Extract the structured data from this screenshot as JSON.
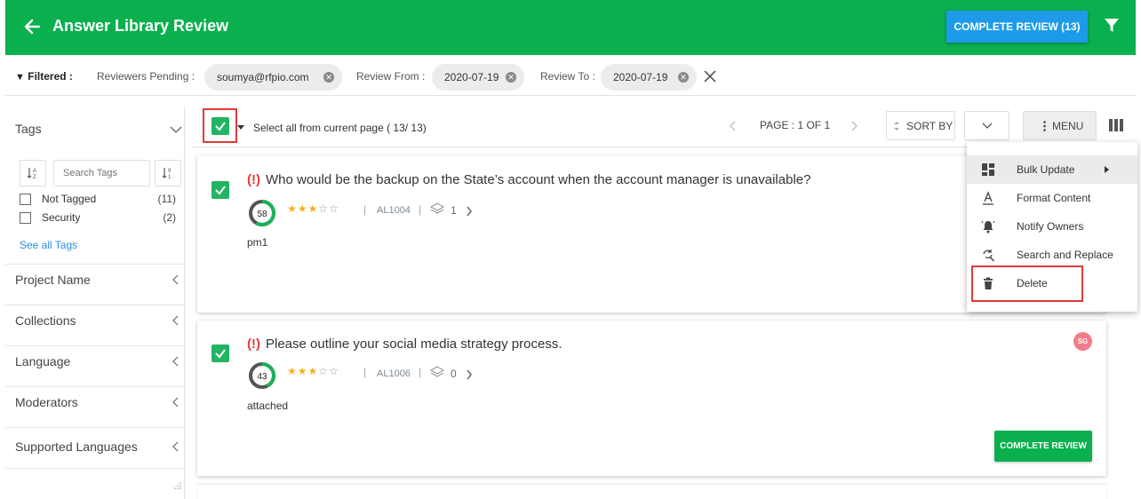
{
  "header": {
    "title": "Answer Library Review",
    "complete_review_label": "COMPLETE REVIEW (13)",
    "bg_color": "#0aaf4e"
  },
  "filters": {
    "label": "Filtered :",
    "reviewers_label": "Reviewers Pending :",
    "reviewers_value": "soumya@rfpio.com",
    "from_label": "Review From :",
    "from_value": "2020-07-19",
    "to_label": "Review To :",
    "to_value": "2020-07-19"
  },
  "sidebar": {
    "tags_title": "Tags",
    "search_placeholder": "Search Tags",
    "tags": [
      {
        "label": "Not Tagged",
        "count": "(11)"
      },
      {
        "label": "Security",
        "count": "(2)"
      }
    ],
    "see_all": "See all Tags",
    "sections": [
      "Project Name",
      "Collections",
      "Language",
      "Moderators",
      "Supported Languages"
    ]
  },
  "toolbar": {
    "select_all_text": "Select all from current page  ( 13/ 13)",
    "page_text": "PAGE : 1 OF 1",
    "sort_by": "SORT BY",
    "menu": "MENU"
  },
  "cards": [
    {
      "question": "Who would be the backup on the State’s account when the account manager is unavailable?",
      "score": "58",
      "score_fraction": 0.58,
      "rating": 3,
      "id": "AL1004",
      "layers": "1",
      "sub": "pm1"
    },
    {
      "question": "Please outline your social media strategy process.",
      "score": "43",
      "score_fraction": 0.43,
      "rating": 3,
      "id": "AL1006",
      "layers": "0",
      "sub": "attached",
      "avatar": "SG",
      "complete_label": "COMPLETE REVIEW"
    }
  ],
  "menu": {
    "items": [
      "Bulk Update",
      "Format Content",
      "Notify Owners",
      "Search and Replace",
      "Delete"
    ]
  }
}
